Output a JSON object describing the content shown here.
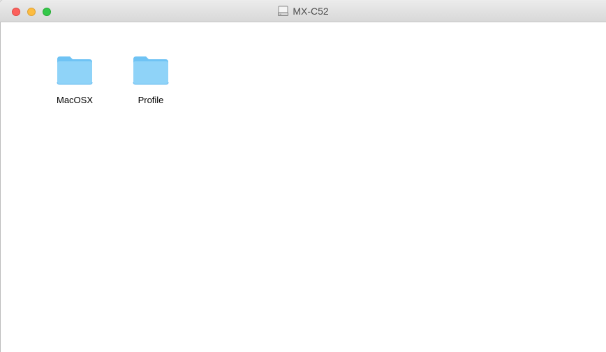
{
  "window": {
    "title": "MX-C52",
    "title_icon": "disk-icon"
  },
  "items": [
    {
      "label": "MacOSX",
      "icon": "folder-icon"
    },
    {
      "label": "Profile",
      "icon": "folder-icon"
    }
  ],
  "colors": {
    "folder_light": "#8fd3f8",
    "folder_dark": "#5fbcef",
    "close": "#fc605c",
    "minimize": "#fdbc40",
    "zoom": "#34c84a"
  }
}
